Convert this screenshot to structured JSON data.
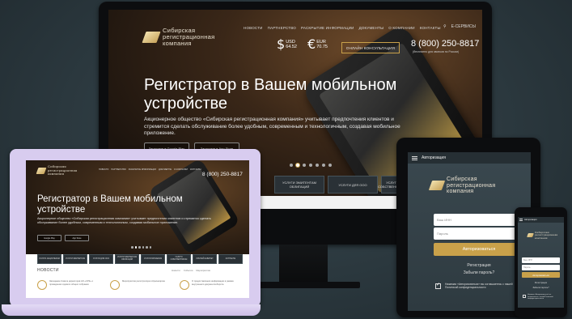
{
  "brand": {
    "logo_text": "Сибирская\nрегистрационная\nкомпания",
    "accent_color": "#c9a14a"
  },
  "desktop": {
    "nav": [
      "НОВОСТИ",
      "ПАРТНЕРСТВО",
      "РАСКРЫТИЕ ИНФОРМАЦИИ",
      "ДОКУМЕНТЫ",
      "О КОМПАНИИ",
      "КОНТАКТЫ"
    ],
    "services_label": "Е-СЕРВИСЫ",
    "search_icon": "search-icon",
    "usd": {
      "symbol": "$",
      "label": "USD",
      "value": "64.52"
    },
    "eur": {
      "symbol": "€",
      "label": "EUR",
      "value": "70.75"
    },
    "online_button": "ОНЛАЙН КОНСУЛЬТАЦИЯ",
    "phone": "8 (800) 250-8817",
    "phone_note": "(бесплатно для звонков по России)",
    "headline": "Регистратор в Вашем мобильном устройстве",
    "description": "Акционерное общество «Сибирская регистрационная компания» учитывает предпочтения клиентов и стремится сделать обслуживание более удобным, современным и технологичным, создавая мобильное приложение.",
    "store_buttons": [
      "Загрузите в Google Play",
      "Загрузите в App Store"
    ],
    "tiles": [
      "УСЛУГИ ЭМИТЕНТАМ ОБЛИГАЦИЙ",
      "УСЛУГИ ДЛЯ ООО",
      "УСЛУГИ СОБСТВЕННИКАМ"
    ]
  },
  "laptop": {
    "nav": [
      "НОВОСТИ",
      "ПАРТНЕРСТВО",
      "РАСКРЫТИЕ ИНФОРМАЦИИ",
      "ДОКУМЕНТЫ",
      "О КОМПАНИИ",
      "КОНТАКТЫ"
    ],
    "phone": "8 (800) 250-8817",
    "headline": "Регистратор в Вашем мобильном устройстве",
    "description": "Акционерное общество «Сибирская регистрационная компания» учитывает предпочтения клиентов и стремится сделать обслуживание более удобным, современным и технологичным, создавая мобильное приложение.",
    "store_buttons": [
      "Google Play",
      "App Store"
    ],
    "tiles": [
      "УСЛУГИ АКЦИОНЕРАМ",
      "УСЛУГИ ЭМИТЕНТАМ",
      "УСЛУГИ ДЛЯ ООО",
      "УСЛУГИ ЭМИТЕНТАМ ОБЛИГАЦИЙ",
      "УСЛУГИ БРОКЕРАМ",
      "УСЛУГИ СОБСТВЕННИКАМ",
      "ЛИЧНЫЙ КАБИНЕТ",
      "КОНТАКТЫ"
    ],
    "news_title": "НОВОСТИ",
    "news_tabs": [
      "Новости",
      "События",
      "Мероприятия"
    ],
    "news_items": [
      "Заседание Совета директоров АО «СРК» о проведении годового общего собрания",
      "Мероприятия регистратора в Красноярске",
      "О предоставлении информации в рамках внутреннего документооборота"
    ]
  },
  "tablet": {
    "header_title": "Авторизация",
    "login_placeholder": "Ваш ИНН",
    "password_placeholder": "Пароль",
    "login_button": "Авторизоваться",
    "register_link": "Регистрация",
    "forgot_link": "Забыли пароль?",
    "consent_text": "Нажимая «Авторизоваться» вы соглашаетесь с нашей Политикой конфиденциальности"
  },
  "phone": {
    "header_title": "Авторизация",
    "login_placeholder": "Ваш ИНН",
    "password_placeholder": "Пароль",
    "login_button": "Авторизоваться",
    "register_link": "Регистрация",
    "forgot_link": "Забыли пароль?",
    "consent_text": "Нажимая «Авторизоваться» вы соглашаетесь с нашей Политикой конфиденциальности"
  }
}
